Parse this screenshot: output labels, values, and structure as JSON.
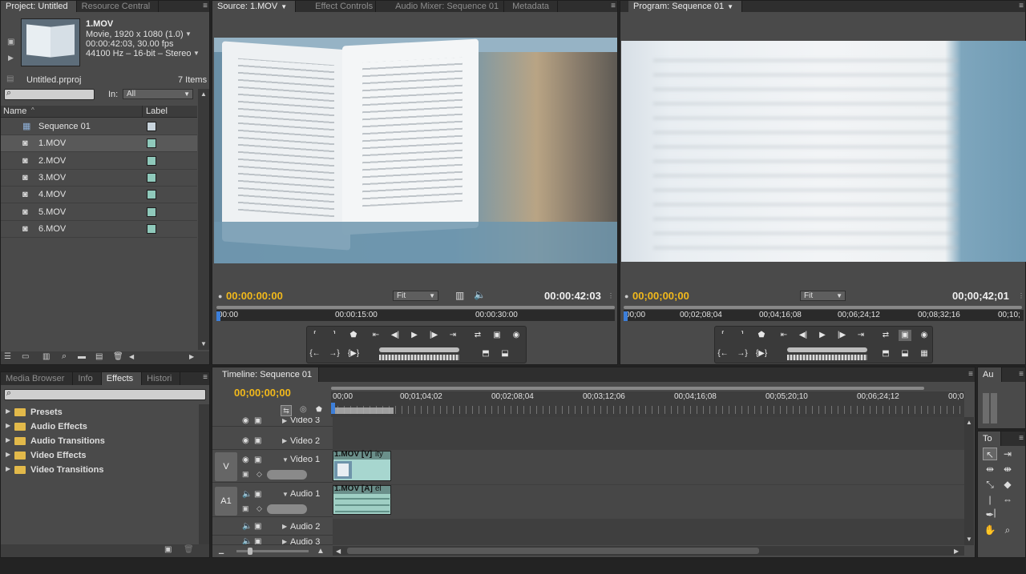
{
  "project": {
    "tabs": [
      "Project: Untitled",
      "Resource Central"
    ],
    "clip_name": "1.MOV",
    "clip_info": [
      "Movie, 1920 x 1080 (1.0)",
      "00:00:42:03, 30.00 fps",
      "44100 Hz – 16-bit – Stereo"
    ],
    "file_name": "Untitled.prproj",
    "item_count": "7 Items",
    "in_label": "In:",
    "in_value": "All",
    "col_name": "Name",
    "col_label": "Label",
    "items": [
      {
        "name": "Sequence 01",
        "color": "#c8d4dc",
        "icon": "sequence-icon"
      },
      {
        "name": "1.MOV",
        "color": "#8fc9bb",
        "icon": "clip-icon"
      },
      {
        "name": "2.MOV",
        "color": "#8fc9bb",
        "icon": "clip-icon"
      },
      {
        "name": "3.MOV",
        "color": "#8fc9bb",
        "icon": "clip-icon"
      },
      {
        "name": "4.MOV",
        "color": "#8fc9bb",
        "icon": "clip-icon"
      },
      {
        "name": "5.MOV",
        "color": "#8fc9bb",
        "icon": "clip-icon"
      },
      {
        "name": "6.MOV",
        "color": "#8fc9bb",
        "icon": "clip-icon"
      }
    ]
  },
  "source": {
    "tabs": [
      "Source: 1.MOV",
      "Effect Controls",
      "Audio Mixer: Sequence 01",
      "Metadata"
    ],
    "timecode": "00:00:00:00",
    "duration": "00:00:42:03",
    "zoom": "Fit",
    "ruler": [
      "00:00",
      "00:00:15:00",
      "00:00:30:00"
    ]
  },
  "program": {
    "tabs": [
      "Program: Sequence 01"
    ],
    "timecode": "00;00;00;00",
    "duration": "00;00;42;01",
    "zoom": "Fit",
    "ruler": [
      "00;00",
      "00;02;08;04",
      "00;04;16;08",
      "00;06;24;12",
      "00;08;32;16",
      "00;10;"
    ]
  },
  "effects": {
    "tabs": [
      "Media Browser",
      "Info",
      "Effects",
      "Histori"
    ],
    "folders": [
      "Presets",
      "Audio Effects",
      "Audio Transitions",
      "Video Effects",
      "Video Transitions"
    ]
  },
  "timeline": {
    "tab": "Timeline: Sequence 01",
    "timecode": "00;00;00;00",
    "ruler": [
      "00;00",
      "00;01;04;02",
      "00;02;08;04",
      "00;03;12;06",
      "00;04;16;08",
      "00;05;20;10",
      "00;06;24;12",
      "00;0"
    ],
    "tracks": [
      "Video 3",
      "Video 2",
      "Video 1",
      "Audio 1",
      "Audio 2",
      "Audio 3"
    ],
    "v_tag": "V",
    "a_tag": "A1",
    "video_clip": "1.MOV [V]",
    "video_clip_fx": "ity",
    "audio_clip": "1.MOV [A]",
    "audio_clip_fx": "el"
  },
  "audio_meter": {
    "tab": "Au"
  },
  "tools": {
    "tab": "To"
  },
  "colors": {
    "accent_timecode": "#f2b91b",
    "playhead": "#c0392b",
    "clip_video": "#a7d6cf",
    "clip_audio": "#9fcfc4"
  }
}
